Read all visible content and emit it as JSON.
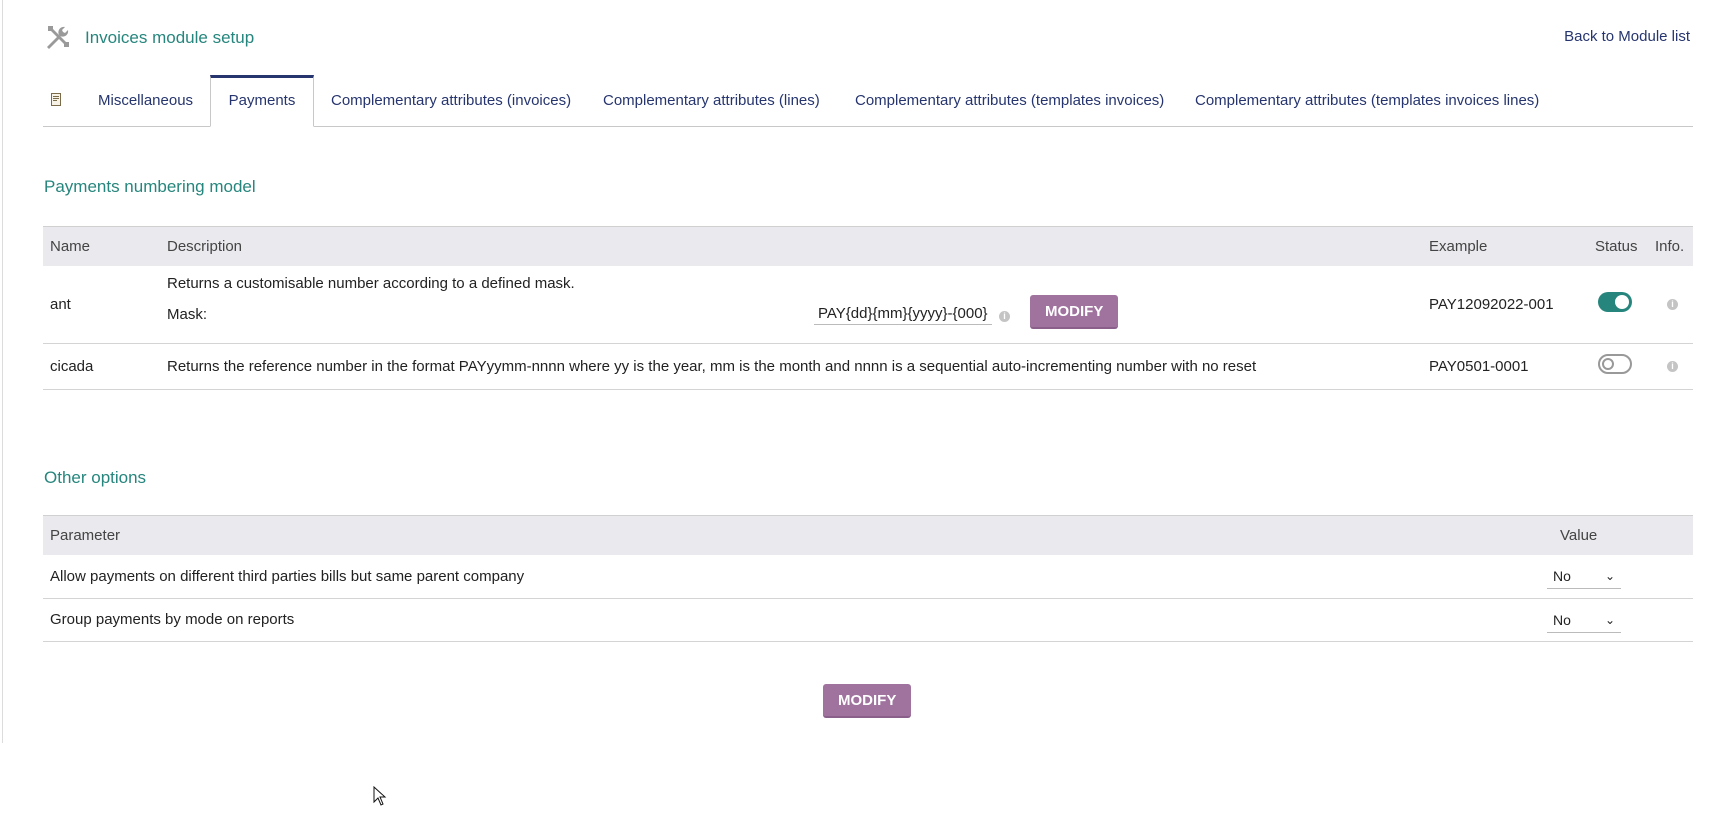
{
  "header": {
    "title": "Invoices module setup",
    "back_link": "Back to Module list"
  },
  "tabs": [
    {
      "label": "Miscellaneous"
    },
    {
      "label": "Payments",
      "active": true
    },
    {
      "label": "Complementary attributes (invoices)"
    },
    {
      "label": "Complementary attributes (lines)"
    },
    {
      "label": "Complementary attributes (templates invoices)"
    },
    {
      "label": "Complementary attributes (templates invoices lines)"
    }
  ],
  "numbering": {
    "section_title": "Payments numbering model",
    "columns": {
      "name": "Name",
      "description": "Description",
      "example": "Example",
      "status": "Status",
      "info": "Info."
    },
    "rows": [
      {
        "name": "ant",
        "description": "Returns a customisable number according to a defined mask.",
        "mask_label": "Mask:",
        "mask_value": "PAY{dd}{mm}{yyyy}-{000}",
        "modify_label": "MODIFY",
        "example": "PAY12092022-001",
        "status": "on"
      },
      {
        "name": "cicada",
        "description": "Returns the reference number in the format PAYyymm-nnnn where yy is the year, mm is the month and nnnn is a sequential auto-incrementing number with no reset",
        "example": "PAY0501-0001",
        "status": "off"
      }
    ]
  },
  "options": {
    "section_title": "Other options",
    "columns": {
      "parameter": "Parameter",
      "value": "Value"
    },
    "rows": [
      {
        "parameter": "Allow payments on different third parties bills but same parent company",
        "value": "No"
      },
      {
        "parameter": "Group payments by mode on reports",
        "value": "No"
      }
    ],
    "modify_label": "MODIFY"
  },
  "colors": {
    "accent": "#26867d",
    "link": "#26356e",
    "button": "#a0739f"
  }
}
